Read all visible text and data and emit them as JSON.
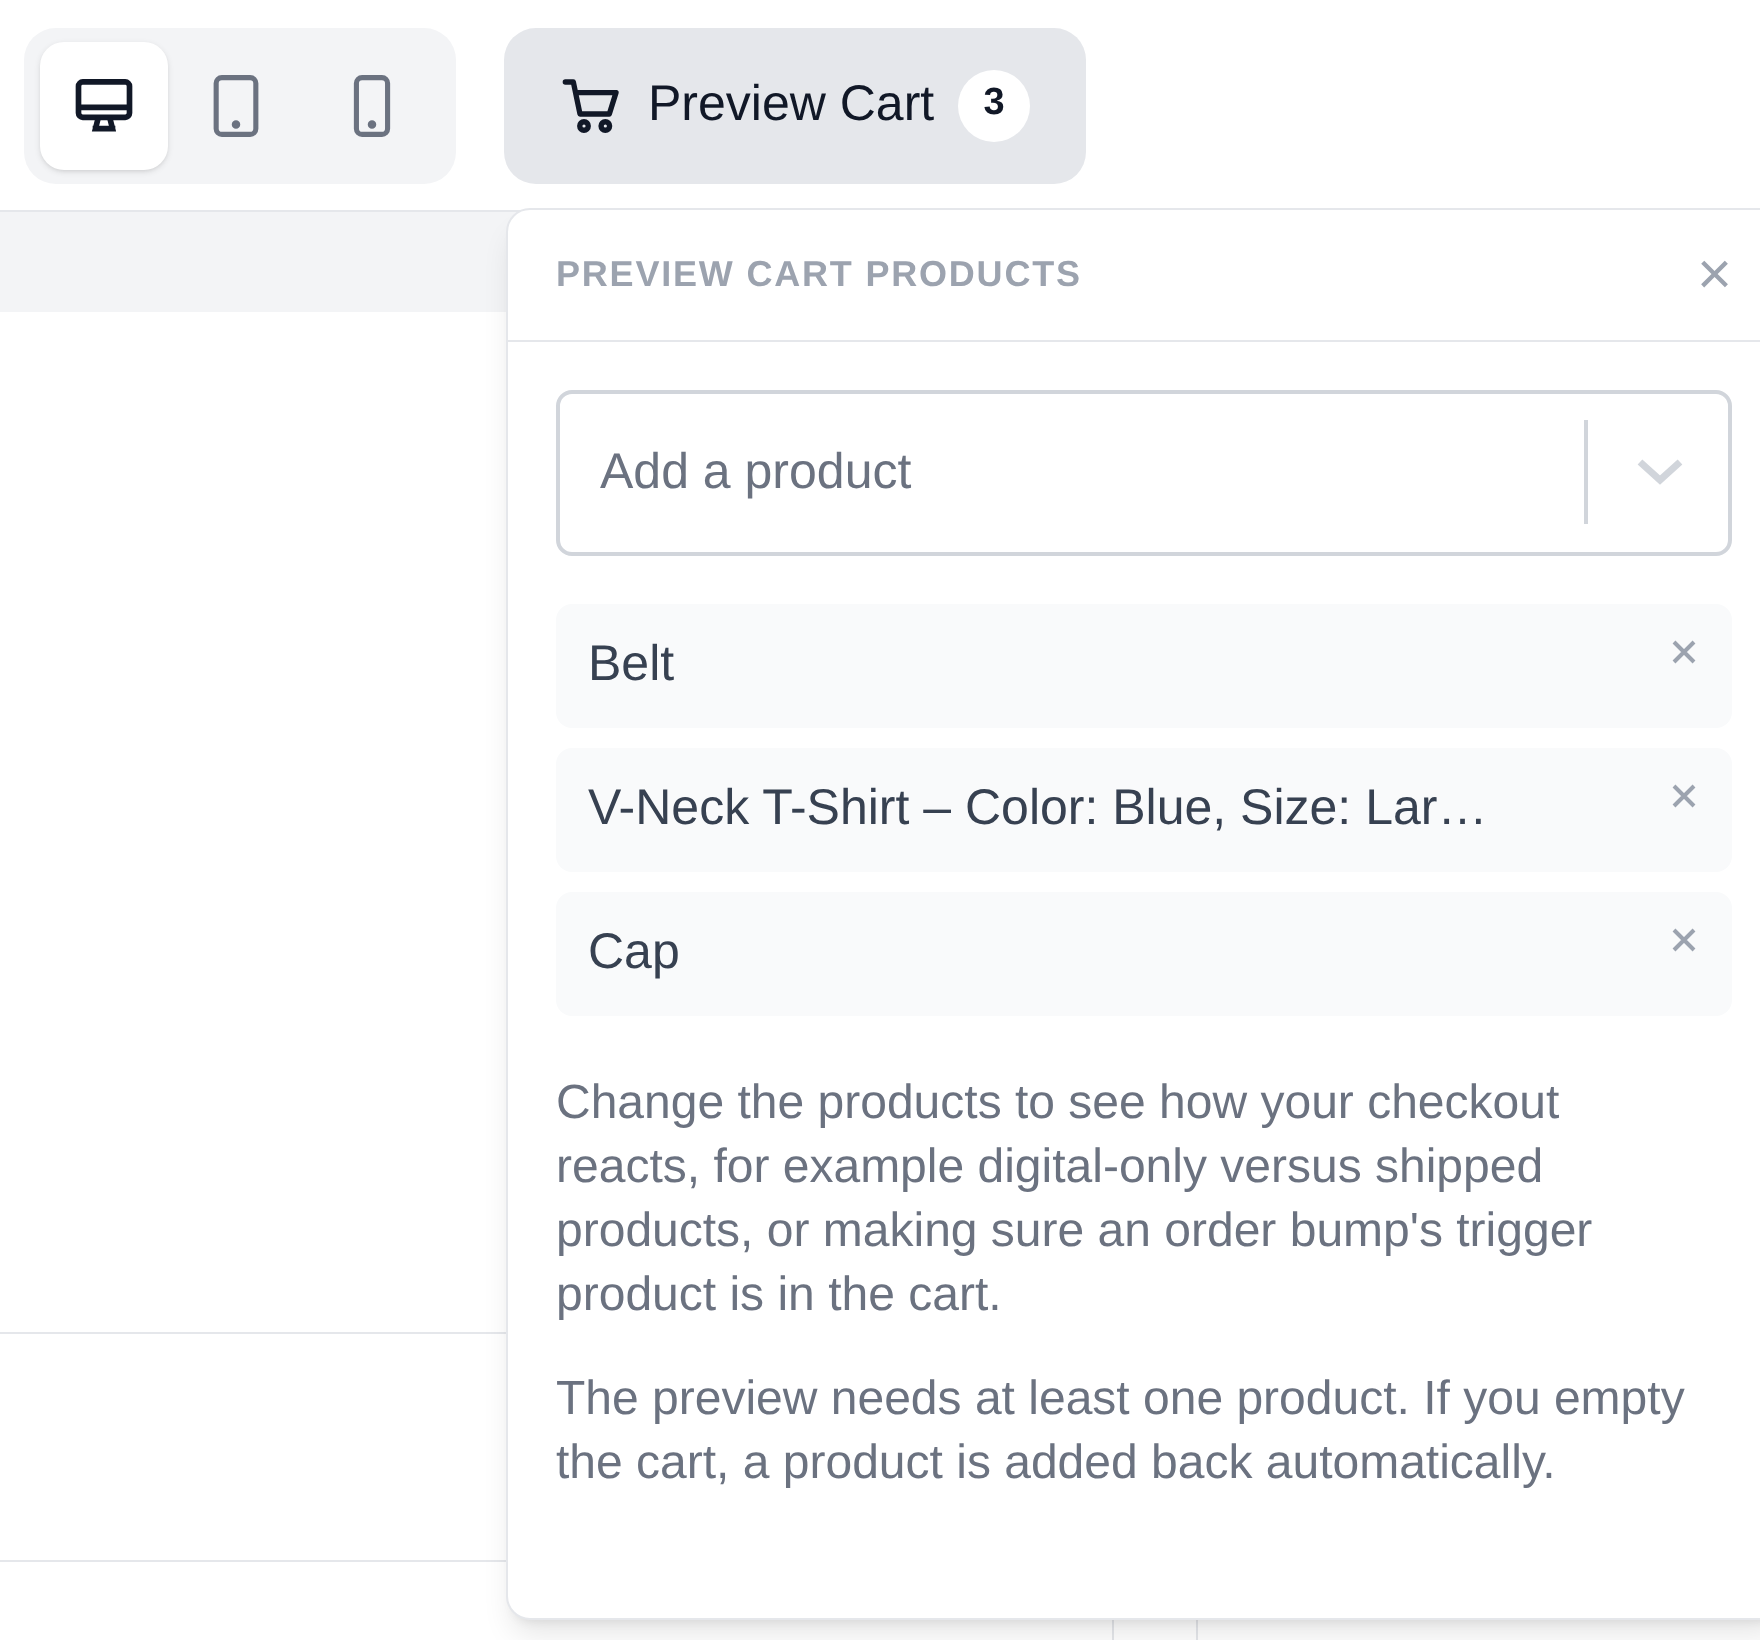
{
  "device_toggle": [
    {
      "kind": "desktop",
      "selected": true
    },
    {
      "kind": "tablet",
      "selected": false
    },
    {
      "kind": "phone",
      "selected": false
    }
  ],
  "cart_button": {
    "label": "Preview Cart",
    "count": "3"
  },
  "panel": {
    "title": "PREVIEW CART PRODUCTS",
    "close": "×",
    "select": {
      "placeholder": "Add a product"
    },
    "products": [
      {
        "name": "Belt"
      },
      {
        "name": "V-Neck T-Shirt – Color: Blue, Size: Lar…"
      },
      {
        "name": "Cap"
      }
    ],
    "notes": [
      "Change the products to see how your checkout reacts, for example digital-only versus shipped products, or making sure an order bump's trigger product is in the cart.",
      "The preview needs at least one product. If you empty the cart, a product is added back automatically."
    ]
  }
}
